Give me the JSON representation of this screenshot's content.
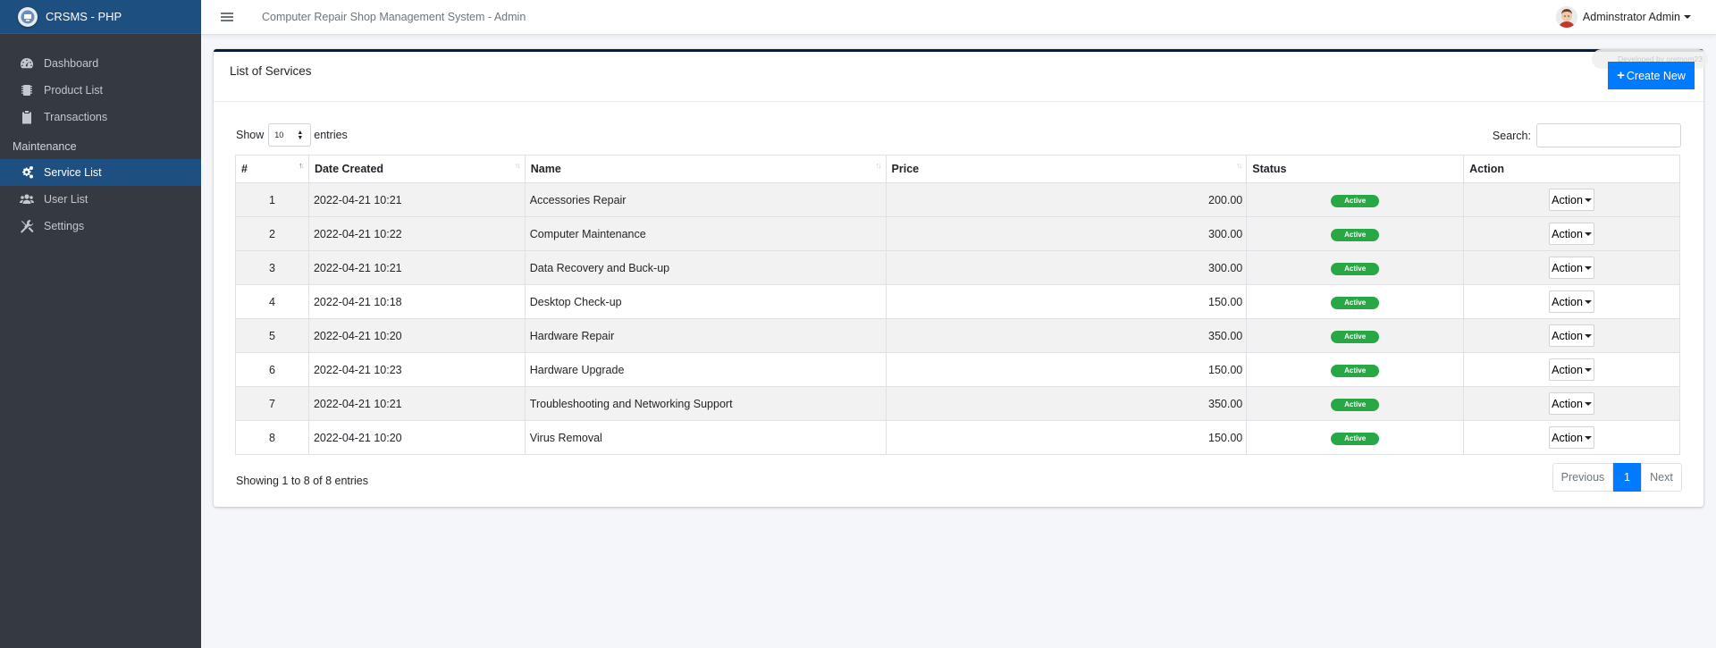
{
  "brand": {
    "name": "CRSMS - PHP"
  },
  "sidebar": {
    "items": [
      {
        "label": "Dashboard",
        "icon": "dashboard-icon"
      },
      {
        "label": "Product List",
        "icon": "chip-icon"
      },
      {
        "label": "Transactions",
        "icon": "clipboard-icon"
      }
    ],
    "section_header": "Maintenance",
    "maintenance_items": [
      {
        "label": "Service List",
        "icon": "cogs-icon",
        "active": true
      },
      {
        "label": "User List",
        "icon": "users-icon"
      },
      {
        "label": "Settings",
        "icon": "tools-icon"
      }
    ]
  },
  "topbar": {
    "title": "Computer Repair Shop Management System - Admin",
    "user_name": "Adminstrator Admin"
  },
  "card": {
    "title": "List of Services",
    "create_label": "Create New",
    "developer_badge": "Developed by oretnom23"
  },
  "table_controls": {
    "show_label": "Show",
    "entries_value": "10",
    "entries_label": "entries",
    "search_label": "Search:",
    "search_value": ""
  },
  "table": {
    "headers": [
      "#",
      "Date Created",
      "Name",
      "Price",
      "Status",
      "Action"
    ],
    "rows": [
      {
        "idx": "1",
        "date": "2022-04-21 10:21",
        "name": "Accessories Repair",
        "price": "200.00",
        "status": "Active",
        "action": "Action"
      },
      {
        "idx": "2",
        "date": "2022-04-21 10:22",
        "name": "Computer Maintenance",
        "price": "300.00",
        "status": "Active",
        "action": "Action"
      },
      {
        "idx": "3",
        "date": "2022-04-21 10:21",
        "name": "Data Recovery and Buck-up",
        "price": "300.00",
        "status": "Active",
        "action": "Action"
      },
      {
        "idx": "4",
        "date": "2022-04-21 10:18",
        "name": "Desktop Check-up",
        "price": "150.00",
        "status": "Active",
        "action": "Action"
      },
      {
        "idx": "5",
        "date": "2022-04-21 10:20",
        "name": "Hardware Repair",
        "price": "350.00",
        "status": "Active",
        "action": "Action"
      },
      {
        "idx": "6",
        "date": "2022-04-21 10:23",
        "name": "Hardware Upgrade",
        "price": "150.00",
        "status": "Active",
        "action": "Action"
      },
      {
        "idx": "7",
        "date": "2022-04-21 10:21",
        "name": "Troubleshooting and Networking Support",
        "price": "350.00",
        "status": "Active",
        "action": "Action"
      },
      {
        "idx": "8",
        "date": "2022-04-21 10:20",
        "name": "Virus Removal",
        "price": "150.00",
        "status": "Active",
        "action": "Action"
      }
    ]
  },
  "footer": {
    "info": "Showing 1 to 8 of 8 entries",
    "prev_label": "Previous",
    "page_label": "1",
    "next_label": "Next"
  },
  "colors": {
    "sidebar_bg": "#343a40",
    "active_bg": "#1d4f80",
    "primary": "#007bff",
    "success": "#28a745"
  }
}
